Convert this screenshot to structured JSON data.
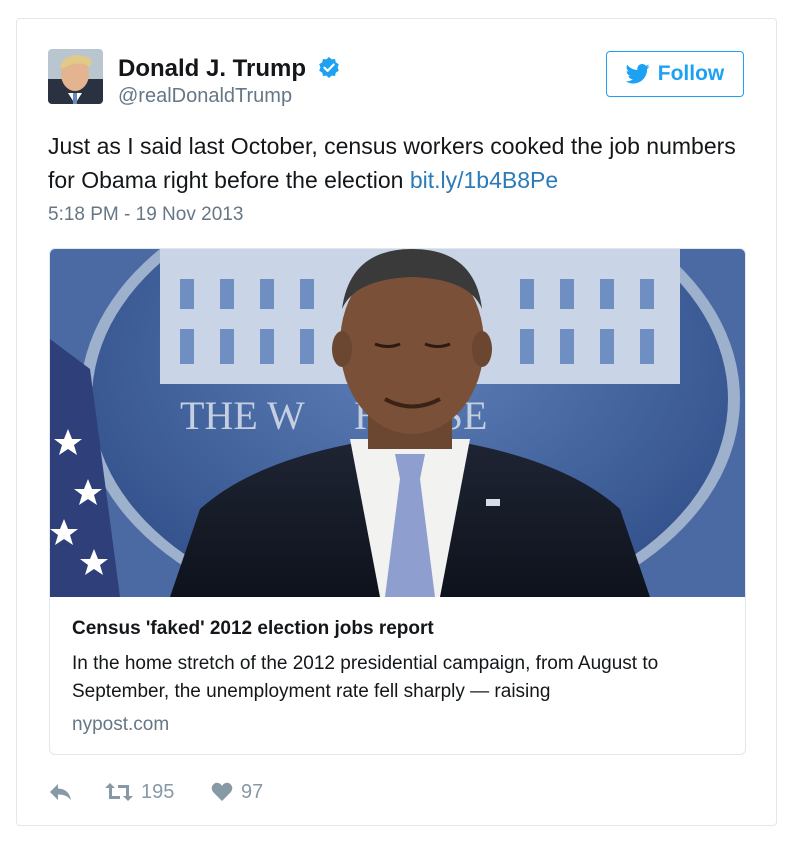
{
  "user": {
    "name": "Donald J. Trump",
    "handle": "@realDonaldTrump",
    "verified": true
  },
  "follow_button": {
    "label": "Follow",
    "icon": "twitter-bird-icon"
  },
  "tweet": {
    "text": "Just as I said last October, census workers cooked the job numbers for Obama right before the election",
    "link": "bit.ly/1b4B8Pe",
    "timestamp": "5:18 PM - 19 Nov 2013"
  },
  "card": {
    "title": "Census 'faked' 2012 election jobs report",
    "description": "In the home stretch of the 2012 presidential campaign, from August to September, the unemployment rate fell sharply — raising",
    "domain": "nypost.com",
    "image_sign_text": "THE W     HOUSE"
  },
  "actions": {
    "reply_icon": "reply-icon",
    "retweet_icon": "retweet-icon",
    "retweet_count": "195",
    "like_icon": "heart-icon",
    "like_count": "97"
  },
  "colors": {
    "accent": "#1da1f2",
    "link": "#2b7bb9",
    "muted": "#657786",
    "icon_gray": "#8899a6",
    "text": "#14171a",
    "border": "#e1e8ed"
  }
}
